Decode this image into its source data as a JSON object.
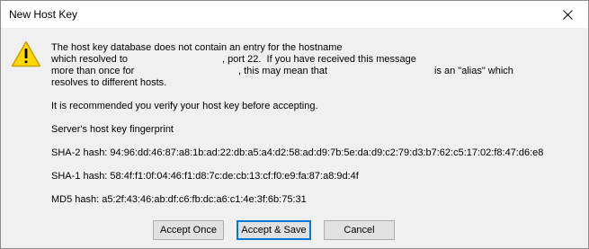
{
  "window": {
    "title": "New Host Key",
    "close_icon": "close-icon"
  },
  "message": {
    "icon": "warning-icon",
    "colors": {
      "warning_fill": "#ffd800",
      "warning_border": "#c8a000"
    },
    "line1": "The host key database does not contain an entry for the hostname",
    "line2a": "which resolved to",
    "line2b": ", port 22.  If you have received this message",
    "line3a": "more than once for",
    "line3b": ", this may mean that",
    "line3c": "is an \"alias\" which",
    "line4": "resolves to different hosts.",
    "recommendation": "It is recommended you verify your host key before accepting.",
    "fingerprint_heading": "Server's host key fingerprint"
  },
  "fingerprints": {
    "sha2": "SHA-2 hash: 94:96:dd:46:87:a8:1b:ad:22:db:a5:a4:d2:58:ad:d9:7b:5e:da:d9:c2:79:d3:b7:62:c5:17:02:f8:47:d6:e8",
    "sha1": "SHA-1 hash: 58:4f:f1:0f:04:46:f1:d8:7c:de:cb:13:cf:f0:e9:fa:87:a8:9d:4f",
    "md5": "MD5 hash: a5:2f:43:46:ab:df:c6:fb:dc:a6:c1:4e:3f:6b:75:31"
  },
  "buttons": {
    "accept_once": "Accept Once",
    "accept_save": "Accept & Save",
    "cancel": "Cancel"
  },
  "colors": {
    "content_background": "#f0f0f0",
    "button_background": "#e1e1e1",
    "default_button_border": "#0078d7"
  }
}
